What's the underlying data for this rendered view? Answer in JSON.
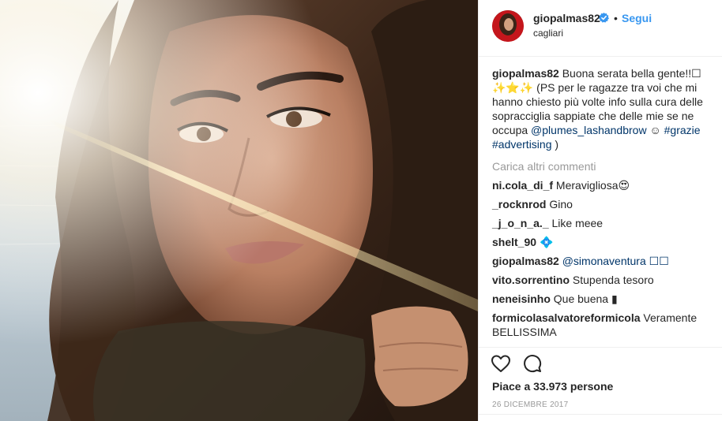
{
  "post": {
    "username": "giopalmas82",
    "follow_label": "Segui",
    "separator": "•",
    "location": "cagliari",
    "verified_icon": "verified-badge-icon",
    "caption_user": "giopalmas82",
    "caption_text": "Buona serata bella gente!!☐ ✨⭐✨ (PS per le ragazze tra voi che mi hanno chiesto più volte info sulla cura delle sopracciglia sappiate che delle mie se ne occupa ",
    "caption_mention": "@plumes_lashandbrow",
    "caption_after_mention": " ☺ ",
    "caption_tag1": "#grazie",
    "caption_tag2": "#advertising",
    "caption_end": " )",
    "load_more": "Carica altri commenti",
    "likes": "Piace a 33.973 persone",
    "date": "26 DICEMBRE 2017"
  },
  "comments": [
    {
      "user": "ni.cola_di_f",
      "text": "Meravigliosa😍"
    },
    {
      "user": "_rocknrod",
      "text": "Gino"
    },
    {
      "user": "_j_o_n_a._",
      "text": "Like meee"
    },
    {
      "user": "shelt_90",
      "text": "💠"
    },
    {
      "user": "giopalmas82",
      "text": "@simonaventura ☐☐"
    },
    {
      "user": "vito.sorrentino",
      "text": "Stupenda tesoro"
    },
    {
      "user": "neneisinho",
      "text": "Que buena ▮"
    },
    {
      "user": "formicolasalvatoreformicola",
      "text": "Veramente BELLISSIMA"
    }
  ],
  "icons": {
    "like": "heart-outline-icon",
    "comment": "speech-bubble-icon"
  },
  "colors": {
    "link": "#003569",
    "follow": "#3897f0",
    "muted": "#999999"
  }
}
